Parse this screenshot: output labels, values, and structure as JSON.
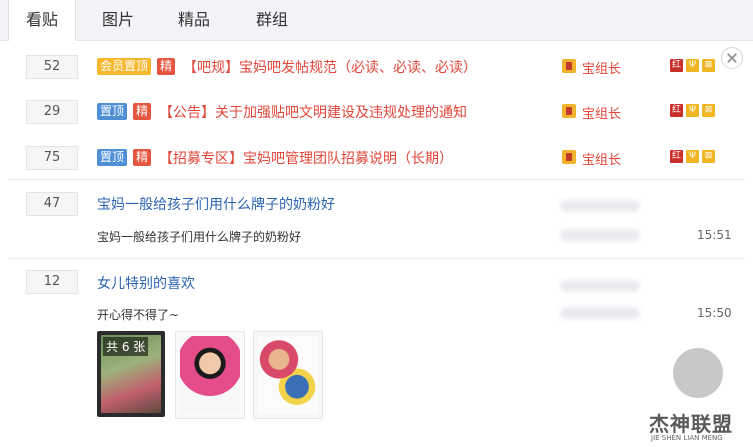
{
  "tabs": [
    {
      "label": "看贴",
      "active": true
    },
    {
      "label": "图片",
      "active": false
    },
    {
      "label": "精品",
      "active": false
    },
    {
      "label": "群组",
      "active": false
    }
  ],
  "threads": [
    {
      "reply_count": "52",
      "badges": [
        "会员置顶",
        "精"
      ],
      "title": "【吧规】宝妈吧发帖规范（必读、必读、必读）",
      "author": "宝组长",
      "medals": [
        "红",
        "Ψ",
        "⊠"
      ]
    },
    {
      "reply_count": "29",
      "badges": [
        "置顶",
        "精"
      ],
      "title": "【公告】关于加强贴吧文明建设及违规处理的通知",
      "author": "宝组长",
      "medals": [
        "红",
        "Ψ",
        "⊠"
      ]
    },
    {
      "reply_count": "75",
      "badges": [
        "置顶",
        "精"
      ],
      "title": "【招募专区】宝妈吧管理团队招募说明（长期）",
      "author": "宝组长",
      "medals": [
        "红",
        "Ψ",
        "⊠"
      ]
    },
    {
      "reply_count": "47",
      "title": "宝妈一般给孩子们用什么牌子的奶粉好",
      "excerpt": "宝妈一般给孩子们用什么牌子的奶粉好",
      "time": "15:51"
    },
    {
      "reply_count": "12",
      "title": "女儿特别的喜欢",
      "excerpt": "开心得不得了~",
      "time": "15:50",
      "image_count_label": "共 6 张"
    }
  ],
  "watermark": {
    "name": "杰神联盟",
    "sub": "JIE SHEN LIAN MENG"
  },
  "colors": {
    "accent_red": "#e0473a",
    "link_blue": "#2d64b3",
    "badge_vip": "#f5b82e",
    "badge_top": "#4e8fd6",
    "badge_jing": "#e5553f"
  }
}
